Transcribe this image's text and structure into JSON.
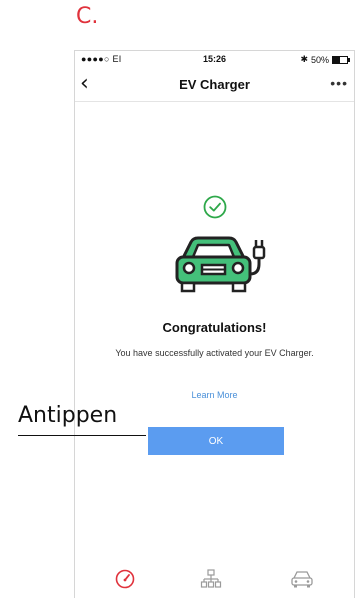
{
  "figure": {
    "letter": "C."
  },
  "status_bar": {
    "carrier": "●●●●○ EI",
    "time": "15:26",
    "battery_text": "50%"
  },
  "nav_bar": {
    "back_glyph": "‹",
    "title": "EV Charger",
    "more_glyph": "•••"
  },
  "content": {
    "heading": "Congratulations!",
    "message": "You have successfully activated your EV Charger.",
    "learn_more": "Learn More",
    "ok_label": "OK"
  },
  "annotation": {
    "label": "Antippen"
  },
  "icons": {
    "check": "check-circle-icon",
    "car": "ev-car-plug-icon",
    "tab1": "speedometer-icon",
    "tab2": "network-icon",
    "tab3": "car-icon"
  },
  "colors": {
    "accent_red": "#e0323c",
    "check_green": "#2ea84a",
    "car_green": "#44c07a",
    "button_blue": "#5b9cf0",
    "link_blue": "#4a90d9"
  }
}
